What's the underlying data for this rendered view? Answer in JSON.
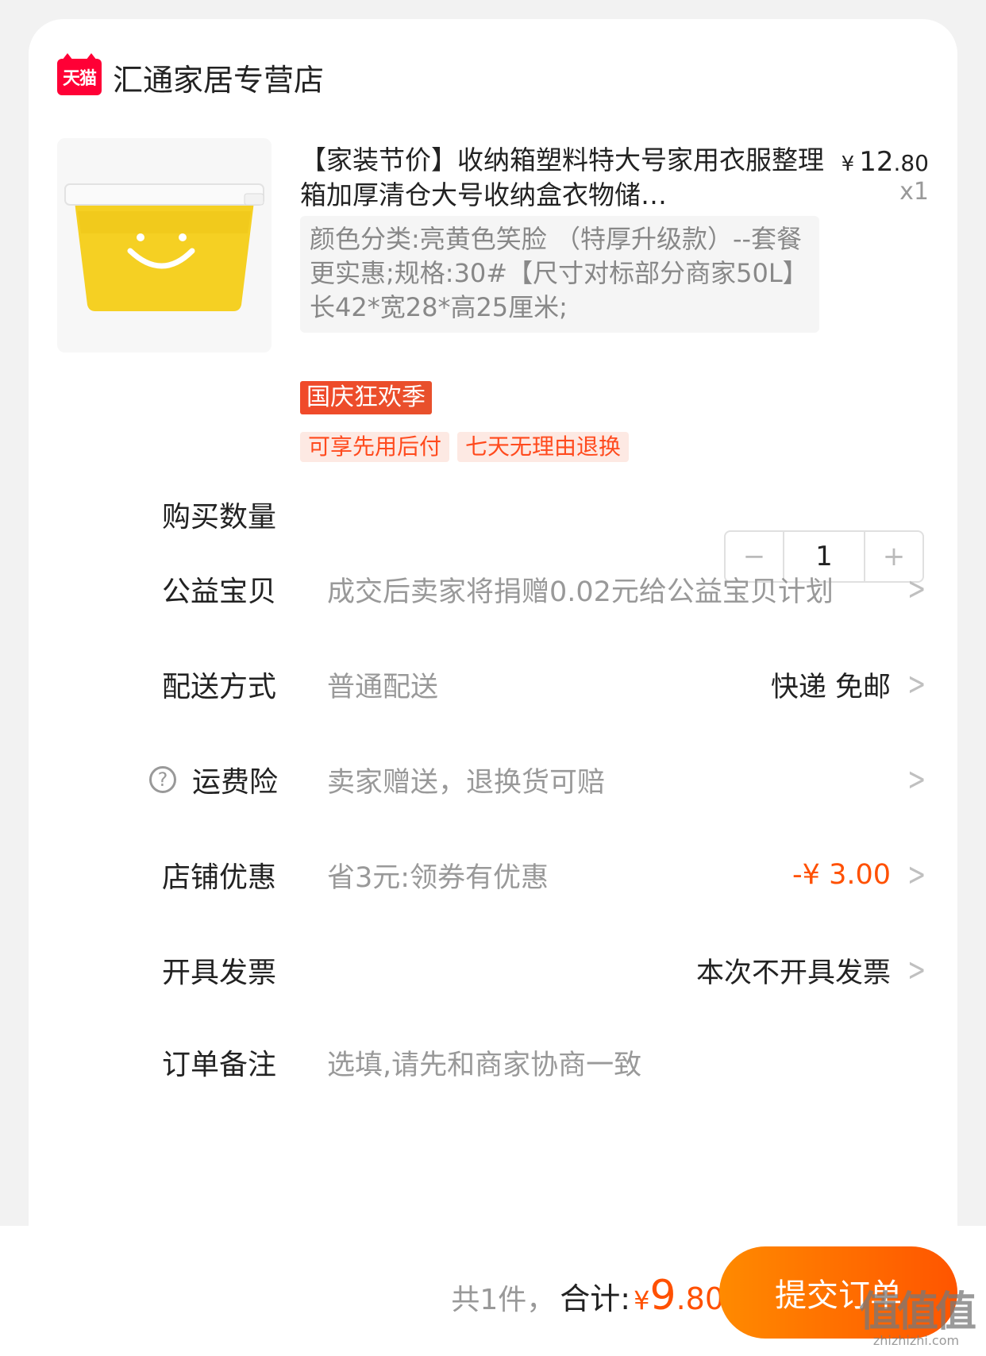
{
  "shop": {
    "logo_text": "天猫",
    "name": "汇通家居专营店"
  },
  "product": {
    "title": "【家装节价】收纳箱塑料特大号家用衣服整理箱加厚清仓大号收纳盒衣物储…",
    "price_currency": "¥",
    "price_int": "12",
    "price_dec": ".80",
    "quantity": "x1",
    "sku": "颜色分类:亮黄色笑脸 （特厚升级款）--套餐更实惠;规格:30#【尺寸对标部分商家50L】长42*宽28*高25厘米;",
    "promo_badge": "国庆狂欢季",
    "tags": [
      "可享先用后付",
      "七天无理由退换"
    ]
  },
  "rows": {
    "quantity": {
      "label": "购买数量",
      "minus": "−",
      "value": "1",
      "plus": "+"
    },
    "charity": {
      "label": "公益宝贝",
      "desc": "成交后卖家将捐赠0.02元给公益宝贝计划"
    },
    "delivery": {
      "label": "配送方式",
      "desc": "普通配送",
      "value": "快递 免邮"
    },
    "insurance": {
      "label": "运费险",
      "desc": "卖家赠送，退换货可赔"
    },
    "coupon": {
      "label": "店铺优惠",
      "desc": "省3元:领券有优惠",
      "value": "-¥ 3.00"
    },
    "invoice": {
      "label": "开具发票",
      "value": "本次不开具发票"
    },
    "remark": {
      "label": "订单备注",
      "placeholder": "选填,请先和商家协商一致"
    }
  },
  "footer": {
    "count": "共1件，",
    "total_label": "合计:",
    "currency": "¥",
    "total_int": "9",
    "total_dec": ".80",
    "submit": "提交订单"
  },
  "watermark": {
    "top": "值值值",
    "bottom": "zhizhizhi.com"
  },
  "colors": {
    "accent": "#ff5000",
    "tmall": "#ff0036",
    "tag_bg": "#fde9e3"
  },
  "icons": {
    "chevron": "chevron-right-icon",
    "help": "question-circle-icon"
  }
}
